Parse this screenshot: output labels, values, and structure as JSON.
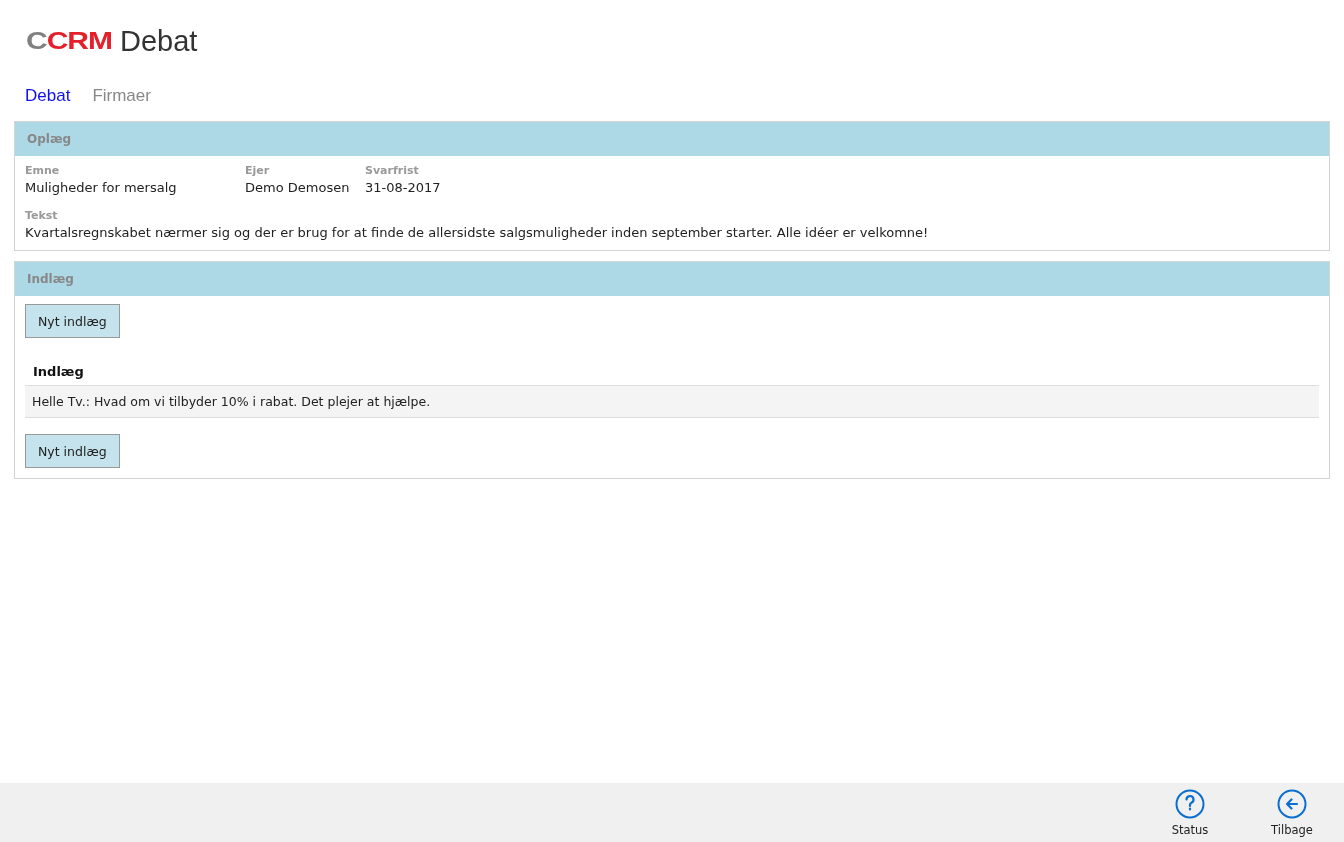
{
  "logo": {
    "mark_grey": "C",
    "mark_red": "CRM",
    "title": "Debat"
  },
  "tabs": [
    {
      "label": "Debat",
      "selected": true
    },
    {
      "label": "Firmaer",
      "selected": false
    }
  ],
  "oplaeg": {
    "header": "Oplæg",
    "fields": [
      {
        "label": "Emne",
        "value": "Muligheder for mersalg"
      },
      {
        "label": "Ejer",
        "value": "Demo Demosen"
      },
      {
        "label": "Svarfrist",
        "value": "31-08-2017"
      }
    ],
    "text_label": "Tekst",
    "text": "Kvartalsregnskabet nærmer sig og der er brug for at finde de allersidste salgsmuligheder inden september starter. Alle idéer er velkomne!"
  },
  "indlaeg": {
    "header": "Indlæg",
    "button_top": "Nyt indlæg",
    "list_heading": "Indlæg",
    "entries": [
      "Helle Tv.: Hvad om vi tilbyder 10% i rabat. Det plejer at hjælpe."
    ],
    "button_bottom": "Nyt indlæg"
  },
  "footer": [
    {
      "kind": "help",
      "label": "Status"
    },
    {
      "kind": "back",
      "label": "Tilbage"
    }
  ]
}
